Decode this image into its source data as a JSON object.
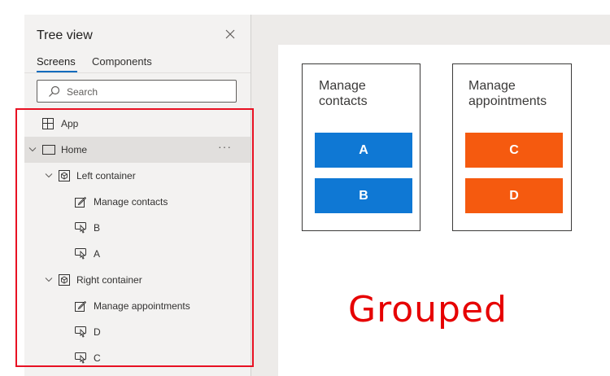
{
  "tree_view": {
    "title": "Tree view",
    "tabs": [
      {
        "label": "Screens",
        "active": true
      },
      {
        "label": "Components",
        "active": false
      }
    ],
    "search_placeholder": "Search",
    "items": [
      {
        "label": "App",
        "icon": "app-icon",
        "level": 0
      },
      {
        "label": "Home",
        "icon": "screen-icon",
        "level": 0,
        "selected": true
      },
      {
        "label": "Left container",
        "icon": "container-icon",
        "level": 1
      },
      {
        "label": "Manage contacts",
        "icon": "label-edit-icon",
        "level": 2
      },
      {
        "label": "B",
        "icon": "button-icon",
        "level": 2
      },
      {
        "label": "A",
        "icon": "button-icon",
        "level": 2
      },
      {
        "label": "Right container",
        "icon": "container-icon",
        "level": 1
      },
      {
        "label": "Manage appointments",
        "icon": "label-edit-icon",
        "level": 2
      },
      {
        "label": "D",
        "icon": "button-icon",
        "level": 2
      },
      {
        "label": "C",
        "icon": "button-icon",
        "level": 2
      }
    ],
    "more_label": "···"
  },
  "canvas": {
    "left_container": {
      "title": "Manage contacts",
      "buttons": [
        "A",
        "B"
      ]
    },
    "right_container": {
      "title": "Manage appointments",
      "buttons": [
        "C",
        "D"
      ]
    },
    "annotation": "Grouped"
  },
  "colors": {
    "blue_button": "#0f78d4",
    "orange_button": "#f55a0f",
    "highlight": "#e81123",
    "annotation": "#e60000"
  }
}
